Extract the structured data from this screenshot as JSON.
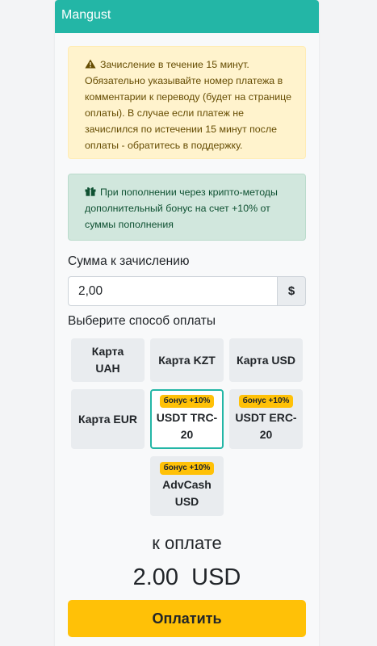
{
  "header": {
    "title": "Mangust"
  },
  "alerts": {
    "warning": {
      "icon": "warning-triangle-icon",
      "text": "Зачисление в течение 15 минут. Обязательно указывайте номер платежа в комментарии к переводу (будет на странице оплаты). В случае если платеж не зачислился по истечении 15 минут после оплаты - обратитесь в поддержку."
    },
    "info": {
      "icon": "gift-icon",
      "text": "При пополнении через крипто-методы дополнительный бонус на счет +10% от суммы пополнения"
    }
  },
  "amount": {
    "label": "Сумма к зачислению",
    "value": "2,00",
    "currency_symbol": "$"
  },
  "methods": {
    "label": "Выберите способ оплаты",
    "items": [
      {
        "label": "Карта UAH",
        "badge": ""
      },
      {
        "label": "Карта KZT",
        "badge": ""
      },
      {
        "label": "Карта USD",
        "badge": ""
      },
      {
        "label": "Карта EUR",
        "badge": ""
      },
      {
        "label": "USDT TRC-20",
        "badge": "бонус +10%",
        "selected": true
      },
      {
        "label": "USDT ERC-20",
        "badge": "бонус +10%"
      },
      {
        "label": "AdvCash USD",
        "badge": "бонус +10%"
      }
    ]
  },
  "payment": {
    "caption": "к оплате",
    "total": "2.00  USD",
    "button_label": "Оплатить"
  },
  "colors": {
    "header": "#23b6a6",
    "accent_button": "#ffc107",
    "selected_border": "#23b6a6"
  }
}
